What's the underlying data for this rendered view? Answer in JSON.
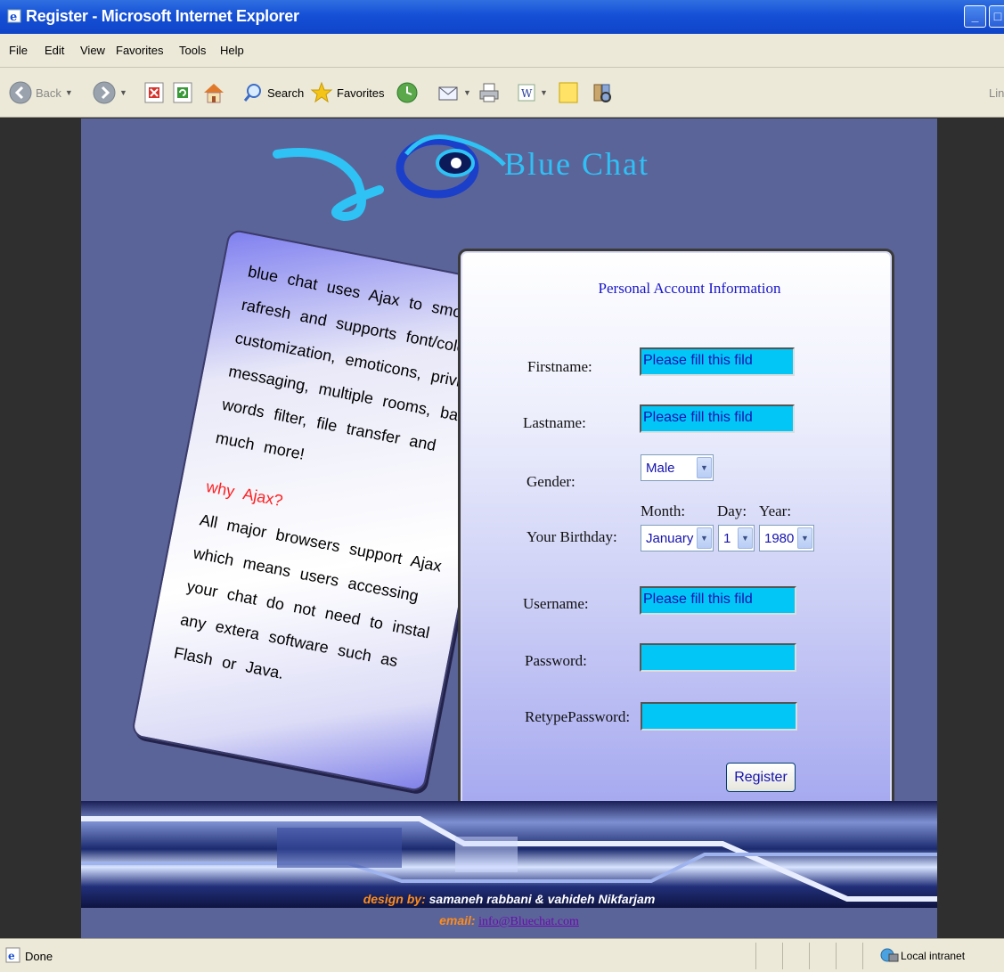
{
  "window": {
    "title": "Register - Microsoft Internet Explorer",
    "buttons": [
      "_",
      "□"
    ]
  },
  "menu": [
    "File",
    "Edit",
    "View",
    "Favorites",
    "Tools",
    "Help"
  ],
  "toolbar": {
    "back": "Back",
    "search": "Search",
    "favorites": "Favorites",
    "links": "Link"
  },
  "page": {
    "logo": "Blue Chat",
    "info": {
      "paragraph1": "blue chat uses Ajax to smooty rafresh and supports font/color customization, emoticons, privite messaging, multiple rooms, bad words filter, file transfer and much more!",
      "why_heading": "why Ajax?",
      "paragraph2": "All major browsers support Ajax which means users accessing your chat do not need to instal any extera software such as Flash or Java."
    },
    "form": {
      "title": "Personal Account Information",
      "firstname_label": "Firstname:",
      "firstname_value": "Please fill this fild",
      "lastname_label": "Lastname:",
      "lastname_value": "Please fill this fild",
      "gender_label": "Gender:",
      "gender_value": "Male",
      "birthday_label": "Your Birthday:",
      "month_label": "Month:",
      "day_label": "Day:",
      "year_label": "Year:",
      "month_value": "January",
      "day_value": "1",
      "year_value": "1980",
      "username_label": "Username:",
      "username_value": "Please fill this fild",
      "password_label": "Password:",
      "retype_label": "RetypePassword:",
      "register_button": "Register"
    },
    "credits": {
      "design_prefix": "design by:",
      "designers": "samaneh rabbani & vahideh Nikfarjam",
      "email_prefix": "email:",
      "email": "info@Bluechat.com"
    }
  },
  "status": {
    "left": "Done",
    "zone": "Local intranet"
  }
}
